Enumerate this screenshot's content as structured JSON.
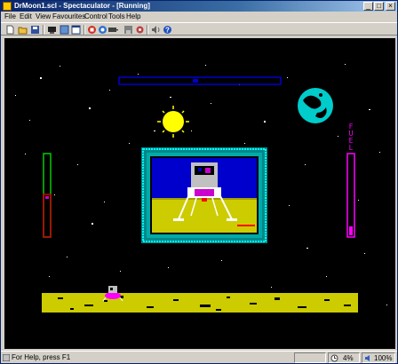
{
  "window": {
    "title": "DrMoon1.scl - Spectaculator - [Running]",
    "controls": {
      "minimize": "_",
      "maximize": "□",
      "close": "×"
    }
  },
  "menu": [
    "File",
    "Edit",
    "View",
    "Favourites",
    "Control",
    "Tools",
    "Help"
  ],
  "toolbar": {
    "icons": [
      "new-icon",
      "open-folder-icon",
      "save-icon",
      "display-icon",
      "fullscreen-icon",
      "window-icon",
      "stop-icon",
      "record-icon",
      "tape-icon",
      "disk-icon",
      "settings-icon",
      "sound-icon",
      "help-icon"
    ]
  },
  "game": {
    "fuel_label": [
      "F",
      "U",
      "E",
      "L"
    ],
    "colors": {
      "fuel": "#ff00ff",
      "frame": "#00cccc",
      "moon_surface": "#cccc00",
      "sun": "#ffff00",
      "earth": "#00cccc",
      "gauge_left": "#00cc00",
      "gauge_left_low": "#cc0000",
      "top_bar": "#0000cc"
    }
  },
  "status": {
    "message": "For Help, press F1",
    "speed": "4%",
    "volume": "100%"
  }
}
